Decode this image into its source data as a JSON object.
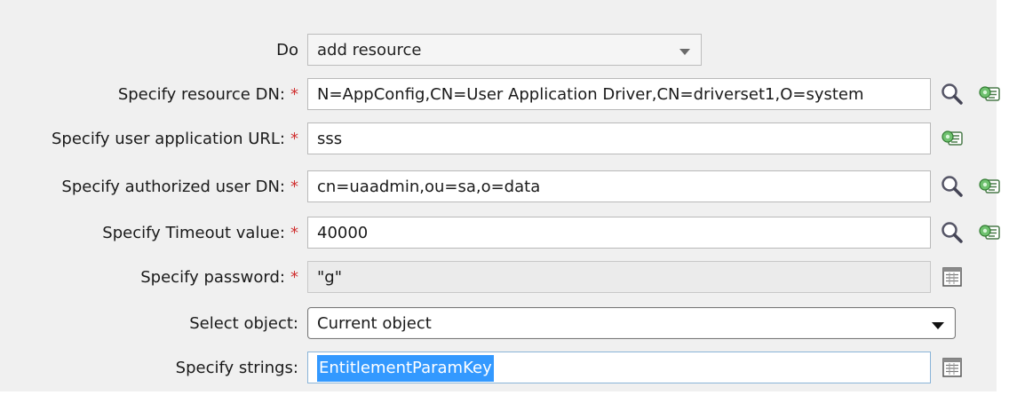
{
  "form": {
    "do": {
      "label": "Do",
      "value": "add resource"
    },
    "resource_dn": {
      "label": "Specify resource DN:",
      "required": "*",
      "value": "N=AppConfig,CN=User Application Driver,CN=driverset1,O=system"
    },
    "user_app_url": {
      "label": "Specify user application URL:",
      "required": "*",
      "value": "sss"
    },
    "authorized_user_dn": {
      "label": "Specify authorized user DN:",
      "required": "*",
      "value": "cn=uaadmin,ou=sa,o=data"
    },
    "timeout": {
      "label": "Specify Timeout value:",
      "required": "*",
      "value": "40000"
    },
    "password": {
      "label": "Specify password:",
      "required": "*",
      "value": "\"g\""
    },
    "select_object": {
      "label": "Select object:",
      "value": "Current object"
    },
    "strings": {
      "label": "Specify strings:",
      "value": "EntitlementParamKey"
    }
  },
  "icons": {
    "browse": "search-icon",
    "argument_builder": "argument-builder-icon",
    "edit_list": "edit-list-icon"
  },
  "colors": {
    "background": "#f0f0f0",
    "required_marker": "#d03030",
    "selection": "#3399ff"
  }
}
